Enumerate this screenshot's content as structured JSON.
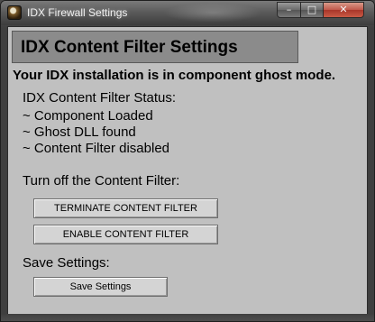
{
  "window": {
    "title": "IDX Firewall Settings",
    "controls": {
      "minimize": "–",
      "maximize": "□",
      "close": "✕"
    }
  },
  "header": {
    "title": "IDX Content Filter Settings"
  },
  "notice": "Your IDX installation is in component ghost mode.",
  "status": {
    "heading": "IDX Content Filter Status:",
    "lines": [
      "~ Component Loaded",
      "~ Ghost DLL found",
      "~ Content Filter disabled"
    ]
  },
  "turn_off": {
    "label": "Turn off the Content Filter:",
    "terminate_button": "TERMINATE CONTENT FILTER",
    "enable_button": "ENABLE CONTENT FILTER"
  },
  "save": {
    "label": "Save Settings:",
    "button": "Save Settings"
  },
  "colors": {
    "client_bg": "#c0c0c0",
    "header_bg": "#8b8b8b",
    "titlebar": "#4a4a4a",
    "close_button": "#c0584a"
  }
}
